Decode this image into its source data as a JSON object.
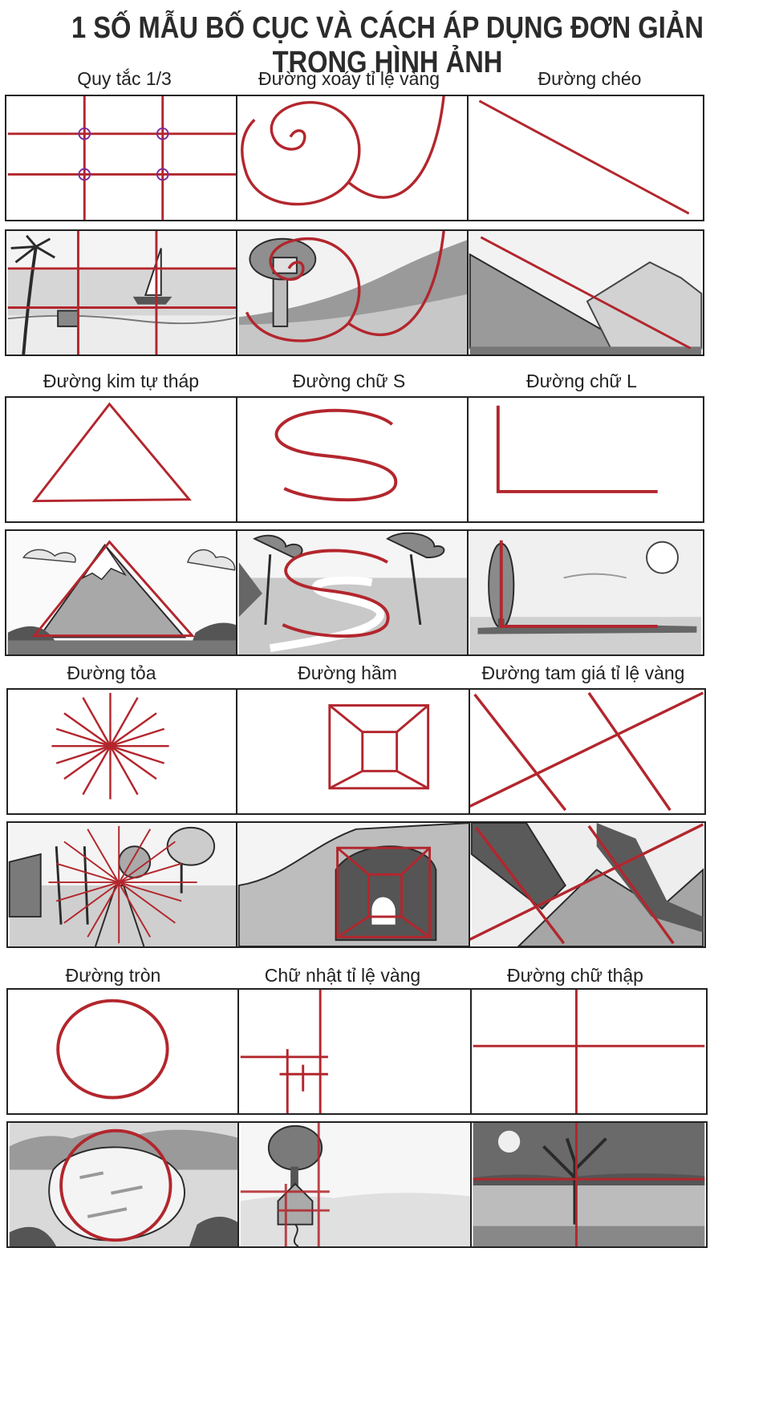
{
  "title": "1 SỐ MẪU BỐ CỤC VÀ CÁCH ÁP DỤNG ĐƠN GIẢN TRONG HÌNH ẢNH",
  "accent_color": "#b3262d",
  "sketch_color": "#2a2a2a",
  "sections": [
    {
      "label": "Quy tắc 1/3"
    },
    {
      "label": "Đường xoáy tỉ lệ vàng"
    },
    {
      "label": "Đường chéo"
    },
    {
      "label": "Đường kim tự tháp"
    },
    {
      "label": "Đường chữ S"
    },
    {
      "label": "Đường chữ L"
    },
    {
      "label": "Đường tỏa"
    },
    {
      "label": "Đường hầm"
    },
    {
      "label": "Đường tam giá tỉ lệ vàng"
    },
    {
      "label": "Đường tròn"
    },
    {
      "label": "Chữ nhật tỉ lệ vàng"
    },
    {
      "label": "Đường chữ thập"
    }
  ]
}
